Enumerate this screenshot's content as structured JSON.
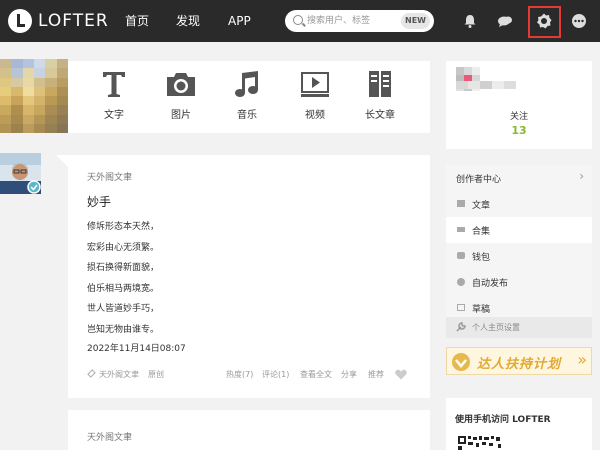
{
  "header": {
    "logo_text": "LOFTER",
    "nav": [
      {
        "label": "首页"
      },
      {
        "label": "发现"
      },
      {
        "label": "APP"
      }
    ],
    "search_placeholder": "搜索用户、标签",
    "search_badge": "NEW",
    "icons": [
      "bell-icon",
      "chat-icon",
      "gear-icon",
      "more-icon"
    ],
    "highlight_color": "#e53935"
  },
  "post_tools": [
    {
      "label": "文字",
      "icon": "text-icon"
    },
    {
      "label": "图片",
      "icon": "camera-icon"
    },
    {
      "label": "音乐",
      "icon": "music-icon"
    },
    {
      "label": "视频",
      "icon": "video-icon"
    },
    {
      "label": "长文章",
      "icon": "article-icon"
    }
  ],
  "post": {
    "source": "天外阁文聿",
    "title": "妙手",
    "lines": [
      "修坼形态本天然，",
      "宏彩由心无须繁。",
      "损石换得新面貌，",
      "伯乐相马两境宽。",
      "世人皆道妙手巧，",
      "岂知无物由谁专。"
    ],
    "date": "2022年11月14日08:07",
    "footer": {
      "tag": "天外阁文聿",
      "original": "原创",
      "hot": "热度(7)",
      "comment": "评论(1)",
      "view_full": "查看全文",
      "share": "分享",
      "recommend": "推荐"
    }
  },
  "post2": {
    "source": "天外阁文聿"
  },
  "profile": {
    "follow_label": "关注",
    "follow_count": "13",
    "accent": "#8bb82d"
  },
  "creator": {
    "title": "创作者中心",
    "items": [
      {
        "label": "文章",
        "icon": "article-icon"
      },
      {
        "label": "合集",
        "icon": "collection-icon"
      },
      {
        "label": "钱包",
        "icon": "wallet-icon"
      },
      {
        "label": "自动发布",
        "icon": "clock-icon"
      },
      {
        "label": "草稿",
        "icon": "draft-icon"
      }
    ],
    "settings": "个人主页设置"
  },
  "banner": {
    "text": "达人扶持计划"
  },
  "mobile": {
    "title": "使用手机访问 LOFTER"
  }
}
